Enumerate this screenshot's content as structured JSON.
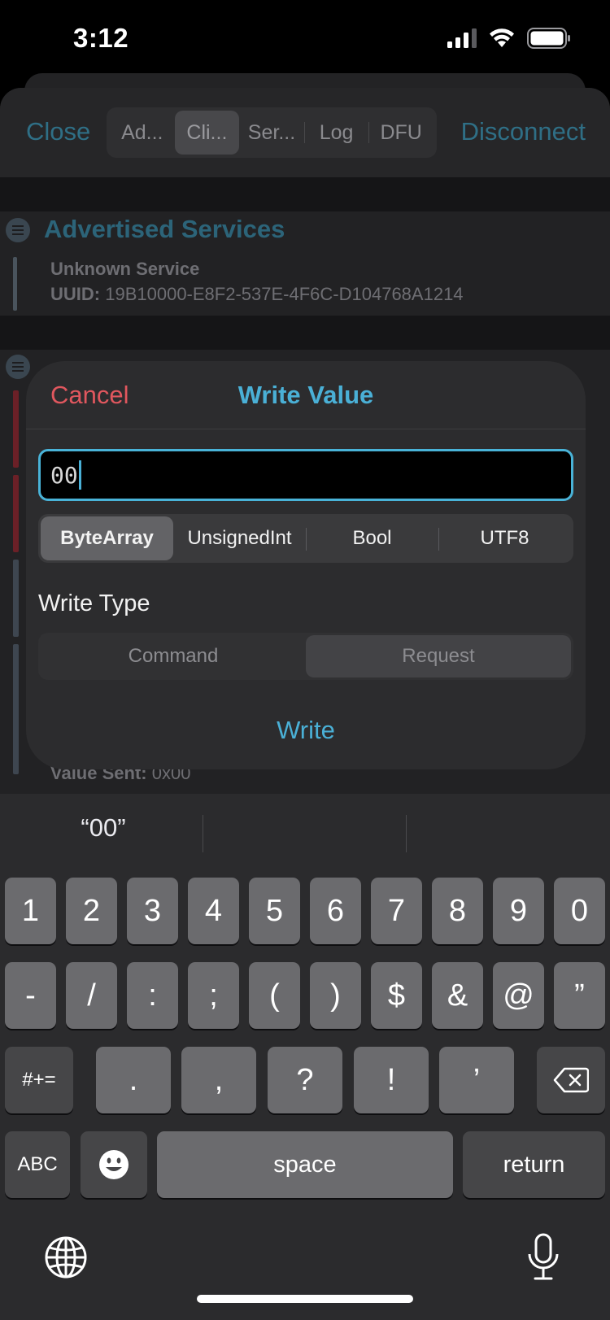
{
  "status_bar": {
    "time": "3:12"
  },
  "nav": {
    "close": "Close",
    "disconnect": "Disconnect",
    "tabs": [
      {
        "label": "Ad...",
        "selected": false
      },
      {
        "label": "Cli...",
        "selected": true
      },
      {
        "label": "Ser...",
        "selected": false
      },
      {
        "label": "Log",
        "selected": false
      },
      {
        "label": "DFU",
        "selected": false
      }
    ]
  },
  "advertised": {
    "title": "Advertised Services",
    "service_name": "Unknown Service",
    "uuid_label": "UUID:",
    "uuid_value": "19B10000-E8F2-537E-4F6C-D104768A1214"
  },
  "value_sent": {
    "label": "Value Sent:",
    "value": "0x00"
  },
  "modal": {
    "cancel": "Cancel",
    "title": "Write Value",
    "input_value": "00",
    "types": [
      "ByteArray",
      "UnsignedInt",
      "Bool",
      "UTF8"
    ],
    "selected_type": "ByteArray",
    "write_type_label": "Write Type",
    "write_types": [
      "Command",
      "Request"
    ],
    "selected_write_type": "Request",
    "write_button": "Write"
  },
  "keyboard": {
    "suggestions": [
      "“00”",
      "",
      ""
    ],
    "row1": [
      "1",
      "2",
      "3",
      "4",
      "5",
      "6",
      "7",
      "8",
      "9",
      "0"
    ],
    "row2": [
      "-",
      "/",
      ":",
      ";",
      "(",
      ")",
      "$",
      "&",
      "@",
      "”"
    ],
    "row3_left": "#+=",
    "row3": [
      ".",
      ",",
      "?",
      "!",
      "’"
    ],
    "abc": "ABC",
    "space": "space",
    "return": "return"
  },
  "colors": {
    "accent": "#4ab0d6",
    "cancel": "#e0575e",
    "dim_accent": "#2f6f86"
  }
}
